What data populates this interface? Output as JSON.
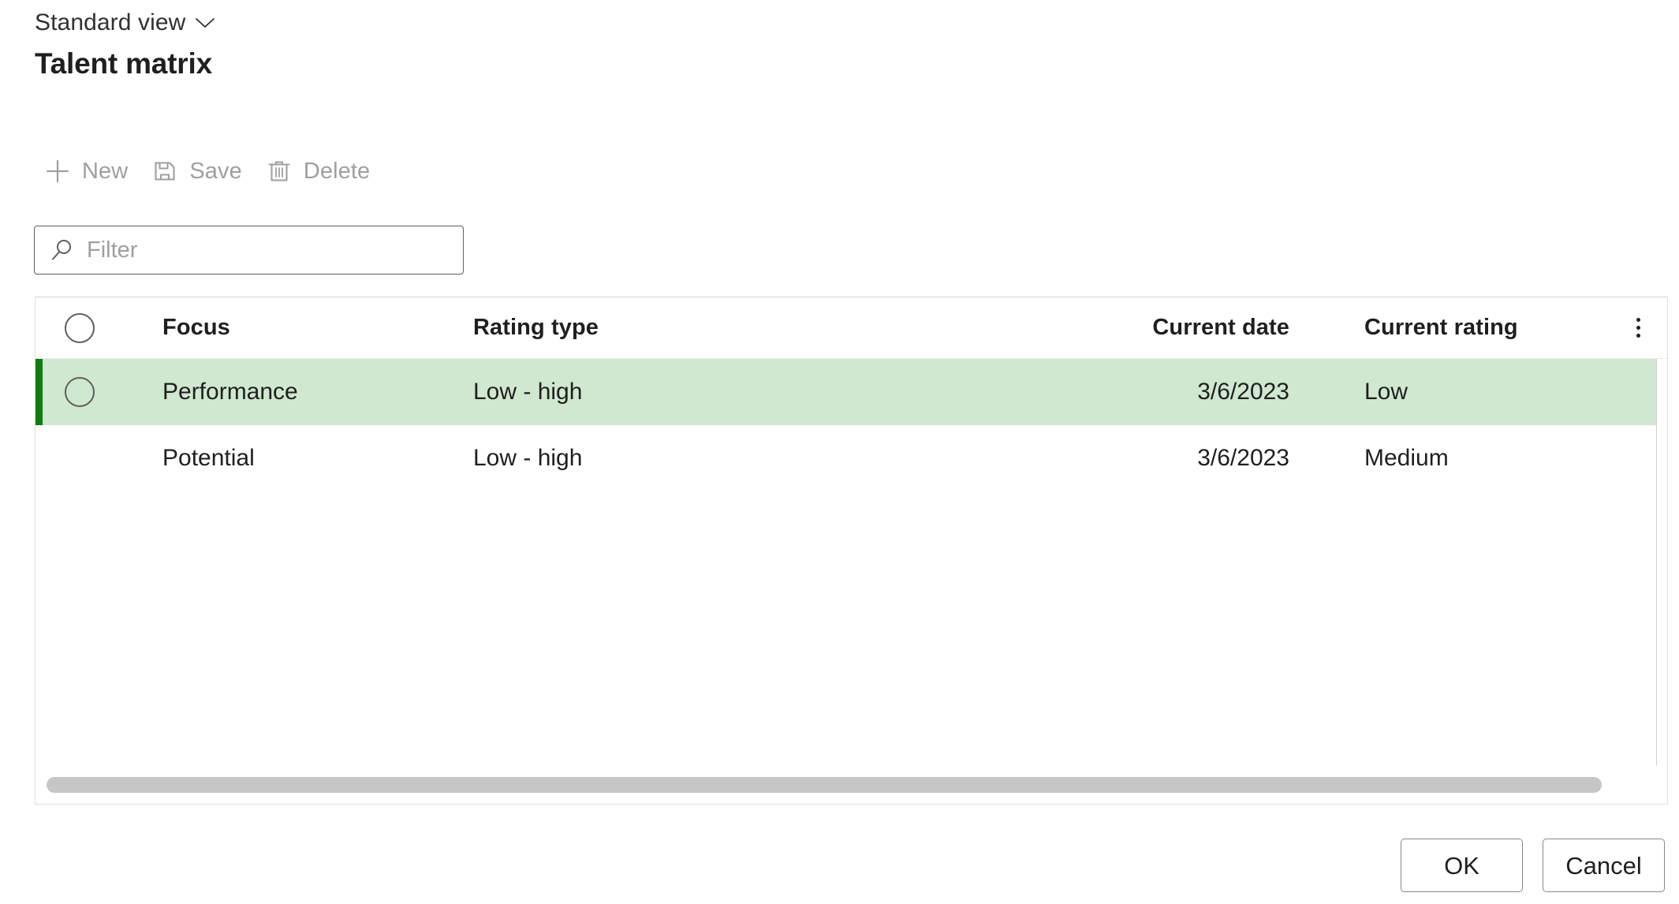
{
  "header": {
    "view_switcher_label": "Standard view",
    "view_switcher_icon": "chevron-down-icon",
    "page_title": "Talent matrix"
  },
  "toolbar": {
    "buttons": [
      {
        "label": "New",
        "icon": "plus-icon",
        "enabled": false
      },
      {
        "label": "Save",
        "icon": "save-floppy-icon",
        "enabled": false
      },
      {
        "label": "Delete",
        "icon": "trash-icon",
        "enabled": false
      }
    ],
    "disabled_color": "#a19f9d"
  },
  "filter": {
    "icon": "search-icon",
    "placeholder": "Filter",
    "value": ""
  },
  "grid": {
    "columns": [
      {
        "key": "select",
        "label": ""
      },
      {
        "key": "focus",
        "label": "Focus"
      },
      {
        "key": "rating_type",
        "label": "Rating type"
      },
      {
        "key": "current_date",
        "label": "Current date"
      },
      {
        "key": "current_rating",
        "label": "Current rating"
      }
    ],
    "header_menu_icon": "more-vertical-kebab-icon",
    "row_select_icon": "radio-circle-icon",
    "rows": [
      {
        "focus": "Performance",
        "rating_type": "Low - high",
        "current_date": "3/6/2023",
        "current_rating": "Low",
        "rating_is_link": true,
        "selected": true
      },
      {
        "focus": "Potential",
        "rating_type": "Low - high",
        "current_date": "3/6/2023",
        "current_rating": "Medium",
        "rating_is_link": false,
        "selected": false
      }
    ],
    "selected_row_background": "#cfe8cf",
    "selected_row_indicator": "#107c10",
    "link_color": "#0f548c",
    "scrollbar_thumb_color": "#c8c6c4"
  },
  "footer": {
    "ok_label": "OK",
    "cancel_label": "Cancel"
  }
}
